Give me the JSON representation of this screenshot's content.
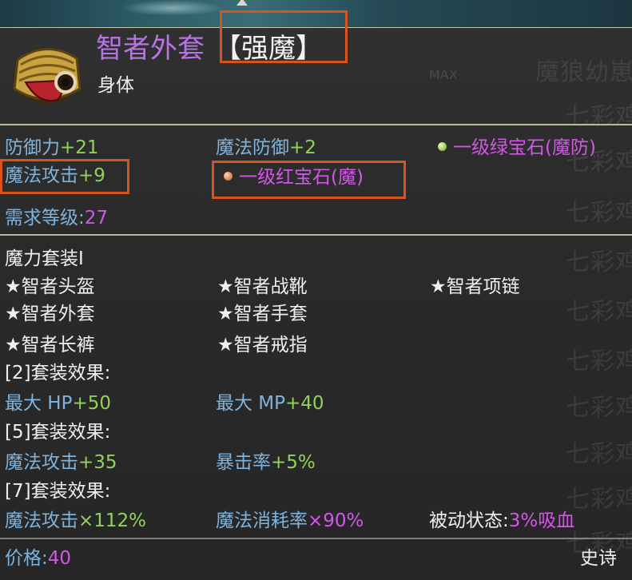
{
  "item": {
    "name": "智者外套",
    "affix": "【强魔】",
    "slot": "身体",
    "max_label": "MAX"
  },
  "stats": {
    "defense_label": "防御力",
    "defense_value": "+21",
    "magic_defense_label": "魔法防御",
    "magic_defense_value": "+2",
    "magic_attack_label": "魔法攻击",
    "magic_attack_value": "+9",
    "gem_green": "一级绿宝石(魔防)",
    "gem_red": "一级红宝石(魔)"
  },
  "requirement": {
    "label": "需求等级:",
    "value": "27"
  },
  "set": {
    "name": "魔力套装Ⅰ",
    "pieces": [
      "★智者头盔",
      "★智者战靴",
      "★智者项链",
      "★智者外套",
      "★智者手套",
      "★智者长裤",
      "★智者戒指"
    ],
    "effect2_label": "[2]套装效果:",
    "effect2_a_label": "最大 HP",
    "effect2_a_value": "+50",
    "effect2_b_label": "最大 MP",
    "effect2_b_value": "+40",
    "effect5_label": "[5]套装效果:",
    "effect5_a_label": "魔法攻击",
    "effect5_a_value": "+35",
    "effect5_b_label": "暴击率",
    "effect5_b_value": "+5%",
    "effect7_label": "[7]套装效果:",
    "effect7_a_label": "魔法攻击",
    "effect7_a_value": "×112%",
    "effect7_b_label": "魔法消耗率",
    "effect7_b_value": "×90%",
    "effect7_c_label": "被动状态:",
    "effect7_c_value": "3%吸血"
  },
  "footer": {
    "price_label": "价格:",
    "price_value": "40",
    "rarity": "史诗"
  },
  "background_list": {
    "items": [
      "魔狼幼崽",
      "七彩鸡",
      "七彩鸡",
      "七彩鸡",
      "七彩鸡",
      "七彩鸡",
      "七彩鸡",
      "七彩鸡",
      "七彩鸡",
      "七彩鸡",
      "七彩鸡"
    ]
  },
  "colors": {
    "title": "#b874e4",
    "cyan_label": "#7fb3dc",
    "green_value": "#8fd35c",
    "purple_value": "#d257e8",
    "highlight_border": "#d9531e"
  }
}
